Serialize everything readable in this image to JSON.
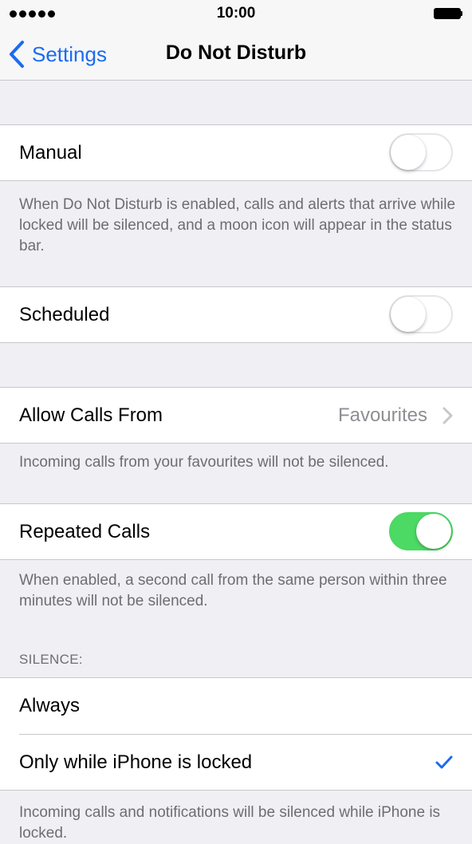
{
  "status_bar": {
    "time": "10:00",
    "signal_icon": "signal-dots-icon",
    "battery_icon": "battery-icon"
  },
  "nav": {
    "back_label": "Settings",
    "title": "Do Not Disturb"
  },
  "manual": {
    "label": "Manual",
    "enabled": false,
    "footer": "When Do Not Disturb is enabled, calls and alerts that arrive while locked will be silenced, and a moon icon will appear in the status bar."
  },
  "scheduled": {
    "label": "Scheduled",
    "enabled": false
  },
  "allow_calls": {
    "label": "Allow Calls From",
    "value": "Favourites",
    "footer": "Incoming calls from your favourites will not be silenced."
  },
  "repeated_calls": {
    "label": "Repeated Calls",
    "enabled": true,
    "footer": "When enabled, a second call from the same person within three minutes will not be silenced."
  },
  "silence": {
    "header": "SILENCE:",
    "options": [
      {
        "label": "Always",
        "selected": false
      },
      {
        "label": "Only while iPhone is locked",
        "selected": true
      }
    ],
    "footer": "Incoming calls and notifications will be silenced while iPhone is locked."
  },
  "colors": {
    "accent": "#1a6cf0",
    "toggle_on": "#4cd964",
    "background": "#efeff4"
  }
}
